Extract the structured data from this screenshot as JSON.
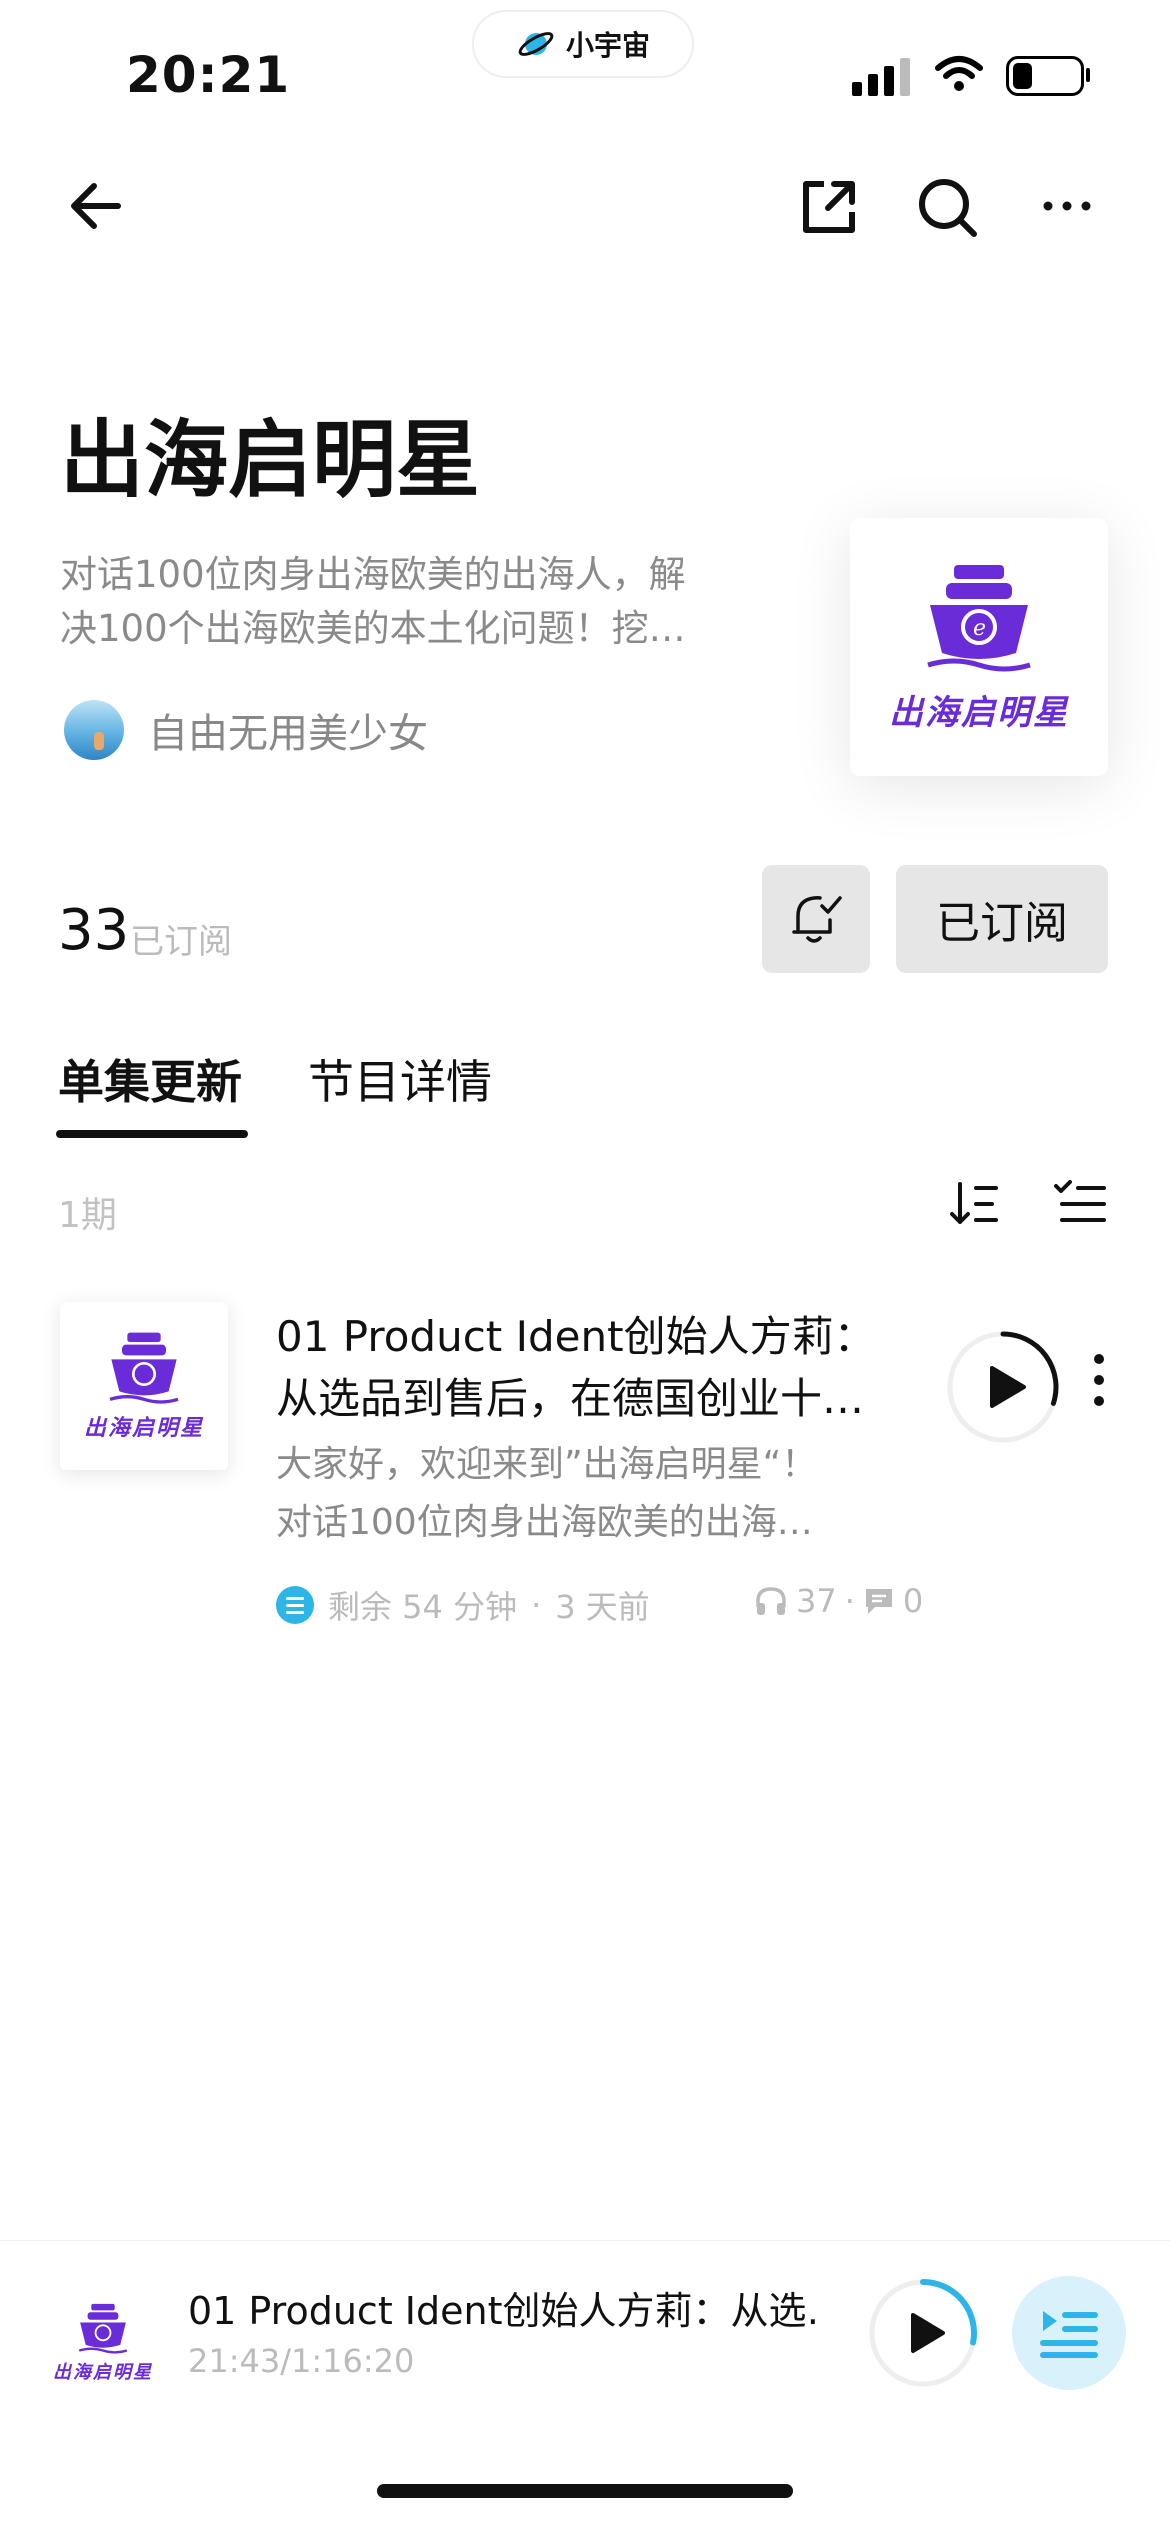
{
  "status_bar": {
    "time": "20:21",
    "island_label": "小宇宙",
    "battery_level": 0.3
  },
  "nav": {
    "back_icon": "arrow-left-icon",
    "share_icon": "share-icon",
    "search_icon": "search-icon",
    "more_icon": "more-dots-icon"
  },
  "podcast": {
    "title": "出海启明星",
    "description_line1": "对话100位肉身出海欧美的出海人，解",
    "description_line2": "决100个出海欧美的本土化问题！挖…",
    "author": "自由无用美少女",
    "cover_text": "出海启明星",
    "brand_color": "#6a2bd9"
  },
  "subscribe": {
    "count": "33",
    "count_label": "已订阅",
    "button_label": "已订阅"
  },
  "tabs": [
    {
      "label": "单集更新",
      "active": true
    },
    {
      "label": "节目详情",
      "active": false
    }
  ],
  "episodes_header": {
    "count": "1期"
  },
  "episodes": [
    {
      "title_line1": "01 Product Ident创始人方莉：",
      "title_line2": "从选品到售后，在德国创业十…",
      "desc_line1": "大家好，欢迎来到”出海启明星“！",
      "desc_line2": "对话100位肉身出海欧美的出海…",
      "remaining": "剩余 54 分钟",
      "dot": "·",
      "published": "3 天前",
      "listens": "37",
      "comments": "0",
      "cover_text": "出海启明星",
      "progress": 0.3
    }
  ],
  "player": {
    "title": "01 Product Ident创始人方莉：从选…",
    "time": "21:43/1:16:20",
    "cover_text": "出海启明星",
    "progress": 0.28,
    "accent": "#2eb5e8"
  }
}
